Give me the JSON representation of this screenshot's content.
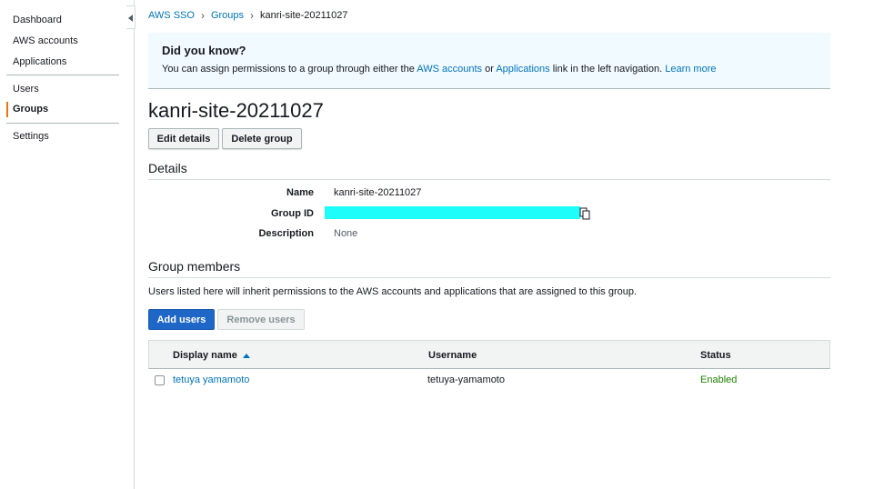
{
  "sidebar": {
    "items": [
      {
        "label": "Dashboard"
      },
      {
        "label": "AWS accounts"
      },
      {
        "label": "Applications"
      },
      {
        "label": "Users"
      },
      {
        "label": "Groups"
      },
      {
        "label": "Settings"
      }
    ],
    "active": "Groups",
    "accent_color": "#ec7211"
  },
  "breadcrumb": {
    "items": [
      "AWS SSO",
      "Groups",
      "kanri-site-20211027"
    ]
  },
  "info": {
    "title": "Did you know?",
    "text_before": "You can assign permissions to a group through either the ",
    "link_accounts": "AWS accounts",
    "text_or": " or ",
    "link_applications": "Applications",
    "text_after": " link in the left navigation. ",
    "link_learn": "Learn more"
  },
  "page": {
    "title": "kanri-site-20211027",
    "edit_button": "Edit details",
    "delete_button": "Delete group"
  },
  "details": {
    "heading": "Details",
    "name_label": "Name",
    "name_value": "kanri-site-20211027",
    "group_id_label": "Group ID",
    "description_label": "Description",
    "description_value": "None",
    "redaction_color": "#1ffdfb"
  },
  "members": {
    "heading": "Group members",
    "description": "Users listed here will inherit permissions to the AWS accounts and applications that are assigned to this group.",
    "add_button": "Add users",
    "remove_button": "Remove users",
    "columns": [
      "Display name",
      "Username",
      "Status"
    ],
    "rows": [
      {
        "display_name": "tetuya yamamoto",
        "username": "tetuya-yamamoto",
        "status": "Enabled"
      }
    ],
    "status_color": "#1d8102",
    "primary_color": "#1f67c6"
  }
}
